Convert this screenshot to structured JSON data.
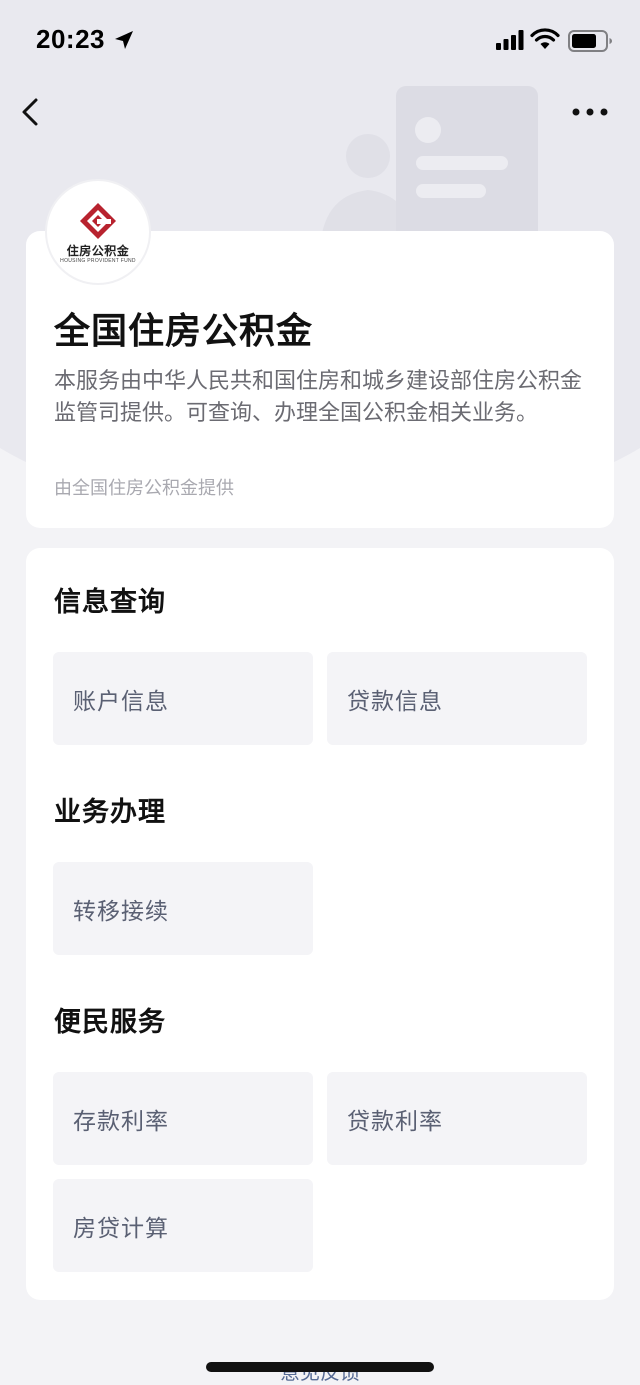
{
  "status_bar": {
    "time": "20:23",
    "location_icon": "location-arrow-icon",
    "signal_icon": "cellular-signal-icon",
    "wifi_icon": "wifi-icon",
    "battery_icon": "battery-icon"
  },
  "nav": {
    "back_icon": "chevron-left-icon",
    "more_icon": "more-horizontal-icon"
  },
  "service_info": {
    "logo_text_cn": "住房公积金",
    "logo_text_en": "HOUSING PROVIDENT FUND",
    "title": "全国住房公积金",
    "description": "本服务由中华人民共和国住房和城乡建设部住房公积金监管司提供。可查询、办理全国公积金相关业务。",
    "provider": "由全国住房公积金提供"
  },
  "sections": [
    {
      "title": "信息查询",
      "items": [
        "账户信息",
        "贷款信息"
      ]
    },
    {
      "title": "业务办理",
      "items": [
        "转移接续"
      ]
    },
    {
      "title": "便民服务",
      "items": [
        "存款利率",
        "贷款利率",
        "房贷计算"
      ]
    }
  ],
  "footer": {
    "feedback": "意见反馈"
  },
  "colors": {
    "brand_red": "#b8232f",
    "tile_bg": "#f4f4f7",
    "tile_text": "#5a6073",
    "link": "#576b95"
  }
}
